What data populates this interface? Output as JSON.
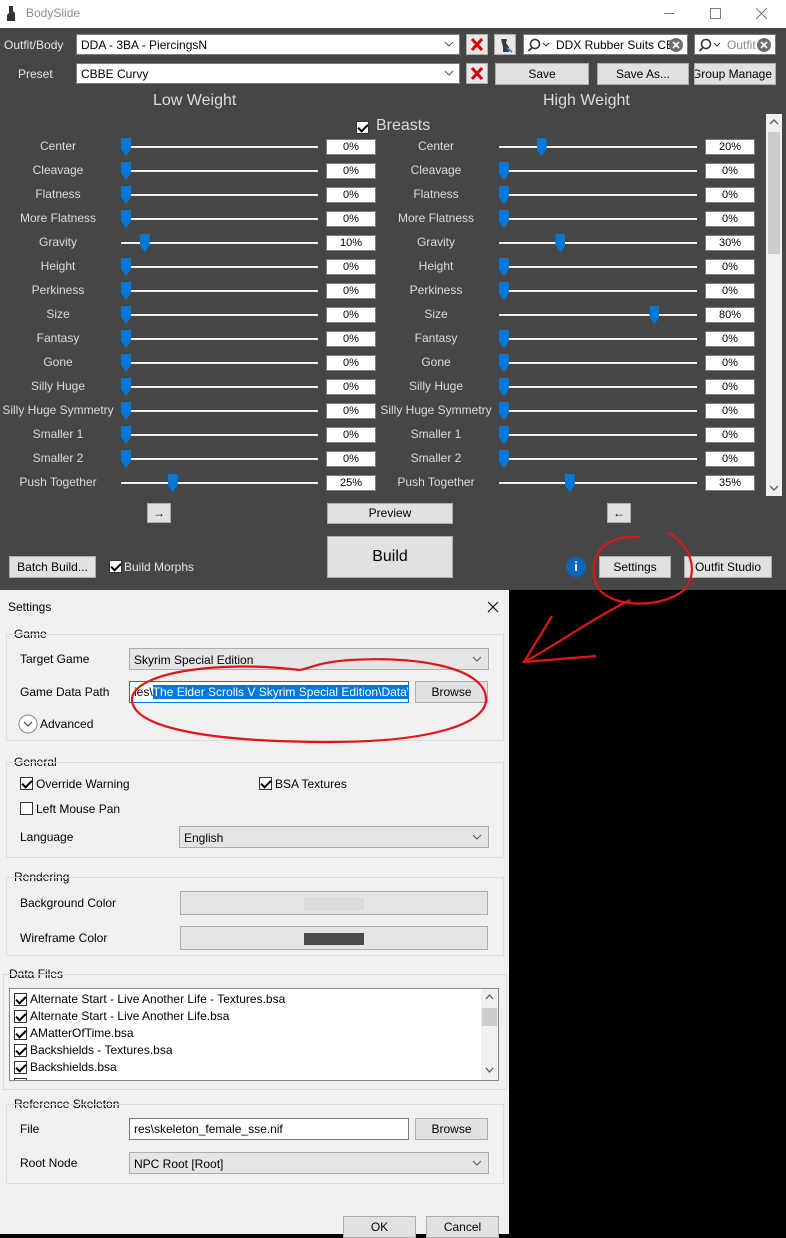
{
  "bodyslide": {
    "window_title": "BodySlide",
    "outfit_body_label": "Outfit/Body",
    "outfit_body_value": "DDA - 3BA - PiercingsN",
    "preset_label": "Preset",
    "preset_value": "CBBE Curvy",
    "save_label": "Save",
    "save_as_label": "Save As...",
    "group_manage_label": "Group Manage",
    "search_outfit_text": "DDX Rubber Suits CB",
    "search_outfit2_text": "Outfit",
    "low_weight_label": "Low Weight",
    "high_weight_label": "High Weight",
    "category_label": "Breasts",
    "category_checked": true,
    "sliders": [
      {
        "name": "Center",
        "low": "0%",
        "high": "20%",
        "low_level": 0,
        "high_level": 20
      },
      {
        "name": "Cleavage",
        "low": "0%",
        "high": "0%",
        "low_level": 0,
        "high_level": 0
      },
      {
        "name": "Flatness",
        "low": "0%",
        "high": "0%",
        "low_level": 0,
        "high_level": 0
      },
      {
        "name": "More Flatness",
        "low": "0%",
        "high": "0%",
        "low_level": 0,
        "high_level": 0
      },
      {
        "name": "Gravity",
        "low": "10%",
        "high": "30%",
        "low_level": 10,
        "high_level": 30
      },
      {
        "name": "Height",
        "low": "0%",
        "high": "0%",
        "low_level": 0,
        "high_level": 0
      },
      {
        "name": "Perkiness",
        "low": "0%",
        "high": "0%",
        "low_level": 0,
        "high_level": 0
      },
      {
        "name": "Size",
        "low": "0%",
        "high": "80%",
        "low_level": 0,
        "high_level": 80
      },
      {
        "name": "Fantasy",
        "low": "0%",
        "high": "0%",
        "low_level": 0,
        "high_level": 0
      },
      {
        "name": "Gone",
        "low": "0%",
        "high": "0%",
        "low_level": 0,
        "high_level": 0
      },
      {
        "name": "Silly Huge",
        "low": "0%",
        "high": "0%",
        "low_level": 0,
        "high_level": 0
      },
      {
        "name": "Silly Huge Symmetry",
        "low": "0%",
        "high": "0%",
        "low_level": 0,
        "high_level": 0
      },
      {
        "name": "Smaller 1",
        "low": "0%",
        "high": "0%",
        "low_level": 0,
        "high_level": 0
      },
      {
        "name": "Smaller 2",
        "low": "0%",
        "high": "0%",
        "low_level": 0,
        "high_level": 0
      },
      {
        "name": "Push Together",
        "low": "25%",
        "high": "35%",
        "low_level": 25,
        "high_level": 35
      }
    ],
    "copy_right_arrow": "→",
    "copy_left_arrow": "←",
    "preview_label": "Preview",
    "build_label": "Build",
    "batch_build_label": "Batch Build...",
    "build_morphs_label": "Build Morphs",
    "build_morphs_checked": true,
    "settings_label": "Settings",
    "outfit_studio_label": "Outfit Studio",
    "info_glyph": "i"
  },
  "settings": {
    "title": "Settings",
    "game_group": "Game",
    "target_game_label": "Target Game",
    "target_game_value": "Skyrim Special Edition",
    "game_data_path_label": "Game Data Path",
    "game_data_path_prefix": "ies\\",
    "game_data_path_selected": "The Elder Scrolls V Skyrim Special Edition\\Data\\",
    "browse_label": "Browse",
    "advanced_label": "Advanced",
    "general_group": "General",
    "override_warning_label": "Override Warning",
    "override_warning_checked": true,
    "bsa_textures_label": "BSA Textures",
    "bsa_textures_checked": true,
    "left_mouse_pan_label": "Left Mouse Pan",
    "left_mouse_pan_checked": false,
    "language_label": "Language",
    "language_value": "English",
    "rendering_group": "Rendering",
    "background_color_label": "Background Color",
    "background_color": "#dcdcdc",
    "wireframe_color_label": "Wireframe Color",
    "wireframe_color": "#4a4a4a",
    "data_files_group": "Data Files",
    "data_files": [
      {
        "label": "Alternate Start - Live Another Life - Textures.bsa",
        "checked": true
      },
      {
        "label": "Alternate Start - Live Another Life.bsa",
        "checked": true
      },
      {
        "label": "AMatterOfTime.bsa",
        "checked": true
      },
      {
        "label": "Backshields - Textures.bsa",
        "checked": true
      },
      {
        "label": "Backshields.bsa",
        "checked": true
      }
    ],
    "reference_skeleton_group": "Reference Skeleton",
    "file_label": "File",
    "file_value": "res\\skeleton_female_sse.nif",
    "file_browse_label": "Browse",
    "root_node_label": "Root Node",
    "root_node_value": "NPC Root [Root]",
    "ok_label": "OK",
    "cancel_label": "Cancel"
  },
  "colors": {
    "accent": "#0078d7",
    "dark_bg": "#464646",
    "annotation_red": "#e0151c"
  }
}
